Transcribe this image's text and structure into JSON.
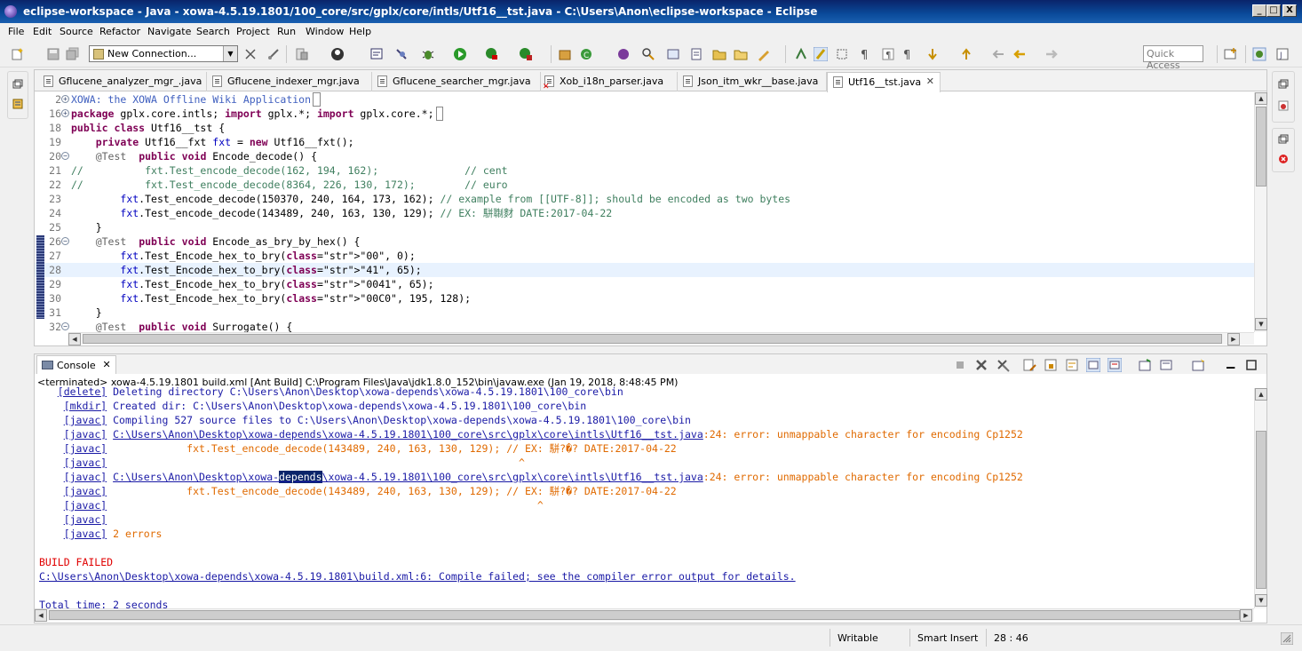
{
  "window": {
    "title": "eclipse-workspace - Java - xowa-4.5.19.1801/100_core/src/gplx/core/intls/Utf16__tst.java - C:\\Users\\Anon\\eclipse-workspace - Eclipse",
    "minimize": "_",
    "maximize": "□",
    "close": "X"
  },
  "menu": [
    "File",
    "Edit",
    "Source",
    "Refactor",
    "Navigate",
    "Search",
    "Project",
    "Run",
    "Window",
    "Help"
  ],
  "toolbar": {
    "connection_value": "New Connection...",
    "quick_access_placeholder": "Quick Access"
  },
  "editor": {
    "tabs": [
      {
        "label": "Gflucene_analyzer_mgr_.java",
        "active": false,
        "error": false
      },
      {
        "label": "Gflucene_indexer_mgr.java",
        "active": false,
        "error": false
      },
      {
        "label": "Gflucene_searcher_mgr.java",
        "active": false,
        "error": false
      },
      {
        "label": "Xob_i18n_parser.java",
        "active": false,
        "error": true
      },
      {
        "label": "Json_itm_wkr__base.java",
        "active": false,
        "error": false
      },
      {
        "label": "Utf16__tst.java",
        "active": true,
        "error": false
      }
    ],
    "lines": [
      {
        "n": "2",
        "fold": "+",
        "t": "XOWA: the XOWA Offline Wiki Application",
        "cls": "jd"
      },
      {
        "n": "16",
        "fold": "+",
        "t": "package gplx.core.intls; import gplx.*; import gplx.core.*;",
        "cls": "pkg"
      },
      {
        "n": "18",
        "fold": "",
        "t": "public class Utf16__tst {",
        "cls": "cls"
      },
      {
        "n": "19",
        "fold": "",
        "t": "    private Utf16__fxt fxt = new Utf16__fxt();",
        "cls": "priv"
      },
      {
        "n": "20",
        "fold": "-",
        "t": "    @Test  public void Encode_decode() {",
        "cls": "test"
      },
      {
        "n": "21",
        "fold": "",
        "t": "//          fxt.Test_encode_decode(162, 194, 162);              // cent",
        "cls": "cm"
      },
      {
        "n": "22",
        "fold": "",
        "t": "//          fxt.Test_encode_decode(8364, 226, 130, 172);        // euro",
        "cls": "cm"
      },
      {
        "n": "23",
        "fold": "",
        "t": "        fxt.Test_encode_decode(150370, 240, 164, 173, 162); // example from [[UTF-8]]; should be encoded as two bytes",
        "cls": "call_cm"
      },
      {
        "n": "24",
        "fold": "",
        "t": "        fxt.Test_encode_decode(143489, 240, 163, 130, 129); // EX: 駢䎺䴭 DATE:2017-04-22",
        "cls": "call_cm"
      },
      {
        "n": "25",
        "fold": "",
        "t": "    }",
        "cls": "plain"
      },
      {
        "n": "26",
        "fold": "-",
        "t": "    @Test  public void Encode_as_bry_by_hex() {",
        "cls": "test"
      },
      {
        "n": "27",
        "fold": "",
        "t": "        fxt.Test_Encode_hex_to_bry(\"00\", 0);",
        "cls": "call_str"
      },
      {
        "n": "28",
        "fold": "",
        "t": "        fxt.Test_Encode_hex_to_bry(\"41\", 65);",
        "cls": "call_str",
        "current": true
      },
      {
        "n": "29",
        "fold": "",
        "t": "        fxt.Test_Encode_hex_to_bry(\"0041\", 65);",
        "cls": "call_str"
      },
      {
        "n": "30",
        "fold": "",
        "t": "        fxt.Test_Encode_hex_to_bry(\"00C0\", 195, 128);",
        "cls": "call_str"
      },
      {
        "n": "31",
        "fold": "",
        "t": "    }",
        "cls": "plain"
      },
      {
        "n": "32",
        "fold": "-",
        "t": "    @Test  public void Surrogate() {",
        "cls": "test"
      }
    ]
  },
  "console": {
    "tab_label": "Console",
    "description": "<terminated> xowa-4.5.19.1801 build.xml [Ant Build] C:\\Program Files\\Java\\jdk1.8.0_152\\bin\\javaw.exe (Jan 19, 2018, 8:48:45 PM)",
    "lines": [
      {
        "tag": "[delete]",
        "text": " Deleting directory C:\\Users\\Anon\\Desktop\\xowa-depends\\xowa-4.5.19.1801\\100_core\\bin",
        "kind": "blue"
      },
      {
        "tag": "[mkdir]",
        "text": " Created dir: C:\\Users\\Anon\\Desktop\\xowa-depends\\xowa-4.5.19.1801\\100_core\\bin",
        "kind": "blue"
      },
      {
        "tag": "[javac]",
        "text": " Compiling 527 source files to C:\\Users\\Anon\\Desktop\\xowa-depends\\xowa-4.5.19.1801\\100_core\\bin",
        "kind": "blue"
      },
      {
        "tag": "[javac]",
        "link": "C:\\Users\\Anon\\Desktop\\xowa-depends\\xowa-4.5.19.1801\\100_core\\src\\gplx\\core\\intls\\Utf16__tst.java",
        "text": ":24: error: unmappable character for encoding Cp1252",
        "kind": "orange"
      },
      {
        "tag": "[javac]",
        "text": "             fxt.Test_encode_decode(143489, 240, 163, 130, 129); // EX: 駢?�? DATE:2017-04-22",
        "kind": "orange"
      },
      {
        "tag": "[javac]",
        "text": "                                                                   ^",
        "kind": "orange"
      },
      {
        "tag": "[javac]",
        "link_pre": "C:\\Users\\Anon\\Desktop\\xowa-",
        "link_sel": "depends",
        "link_post": "\\xowa-4.5.19.1801\\100_core\\src\\gplx\\core\\intls\\Utf16__tst.java",
        "text": ":24: error: unmappable character for encoding Cp1252",
        "kind": "orange_sel"
      },
      {
        "tag": "[javac]",
        "text": "             fxt.Test_encode_decode(143489, 240, 163, 130, 129); // EX: 駢?�? DATE:2017-04-22",
        "kind": "orange"
      },
      {
        "tag": "[javac]",
        "text": "                                                                      ^",
        "kind": "orange"
      },
      {
        "tag": "[javac]",
        "text": "",
        "kind": "orange"
      },
      {
        "tag": "[javac]",
        "text": " 2 errors",
        "kind": "orange"
      },
      {
        "tag": "",
        "text": "",
        "kind": "blank"
      },
      {
        "tag": "",
        "text": "BUILD FAILED",
        "kind": "red"
      },
      {
        "tag": "",
        "link": "C:\\Users\\Anon\\Desktop\\xowa-depends\\xowa-4.5.19.1801\\build.xml:6: Compile failed; see the compiler error output for details.",
        "text": "",
        "kind": "link"
      },
      {
        "tag": "",
        "text": "",
        "kind": "blank"
      },
      {
        "tag": "",
        "text": "Total time: 2 seconds",
        "kind": "bluetext"
      }
    ]
  },
  "status": {
    "writable": "Writable",
    "insert_mode": "Smart Insert",
    "position": "28 : 46"
  }
}
